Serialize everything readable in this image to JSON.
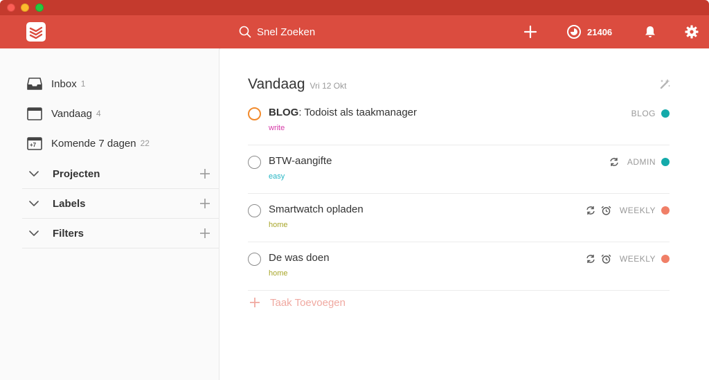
{
  "colors": {
    "brand": "#db4c3f",
    "p1": "#f28a2b",
    "teal": "#14aaaa",
    "salmon": "#f07f67"
  },
  "search": {
    "placeholder": "Snel Zoeken"
  },
  "karma": {
    "score": "21406"
  },
  "nav": [
    {
      "label": "Inbox",
      "count": "1",
      "icon": "inbox-icon"
    },
    {
      "label": "Vandaag",
      "count": "4",
      "icon": "calendar-icon"
    },
    {
      "label": "Komende 7 dagen",
      "count": "22",
      "icon": "calendar-plus7-icon"
    }
  ],
  "calendar_badge": "+7",
  "sections": [
    {
      "label": "Projecten"
    },
    {
      "label": "Labels"
    },
    {
      "label": "Filters"
    }
  ],
  "view": {
    "title": "Vandaag",
    "date": "Vri 12 Okt"
  },
  "tasks": [
    {
      "prefix": "BLOG",
      "title": ": Todoist als taakmanager",
      "label": "write",
      "label_color": "#d63aa8",
      "project": "BLOG",
      "project_color": "#14aaaa",
      "recurring": false,
      "reminder": false,
      "priority": "p1"
    },
    {
      "prefix": "",
      "title": "BTW-aangifte",
      "label": "easy",
      "label_color": "#27b6c4",
      "project": "ADMIN",
      "project_color": "#14aaaa",
      "recurring": true,
      "reminder": false,
      "priority": "p4"
    },
    {
      "prefix": "",
      "title": "Smartwatch opladen",
      "label": "home",
      "label_color": "#a8a62a",
      "project": "WEEKLY",
      "project_color": "#f07f67",
      "recurring": true,
      "reminder": true,
      "priority": "p4"
    },
    {
      "prefix": "",
      "title": "De was doen",
      "label": "home",
      "label_color": "#a8a62a",
      "project": "WEEKLY",
      "project_color": "#f07f67",
      "recurring": true,
      "reminder": true,
      "priority": "p4"
    }
  ],
  "add_task": {
    "label": "Taak Toevoegen",
    "color": "#f0a9a1"
  }
}
